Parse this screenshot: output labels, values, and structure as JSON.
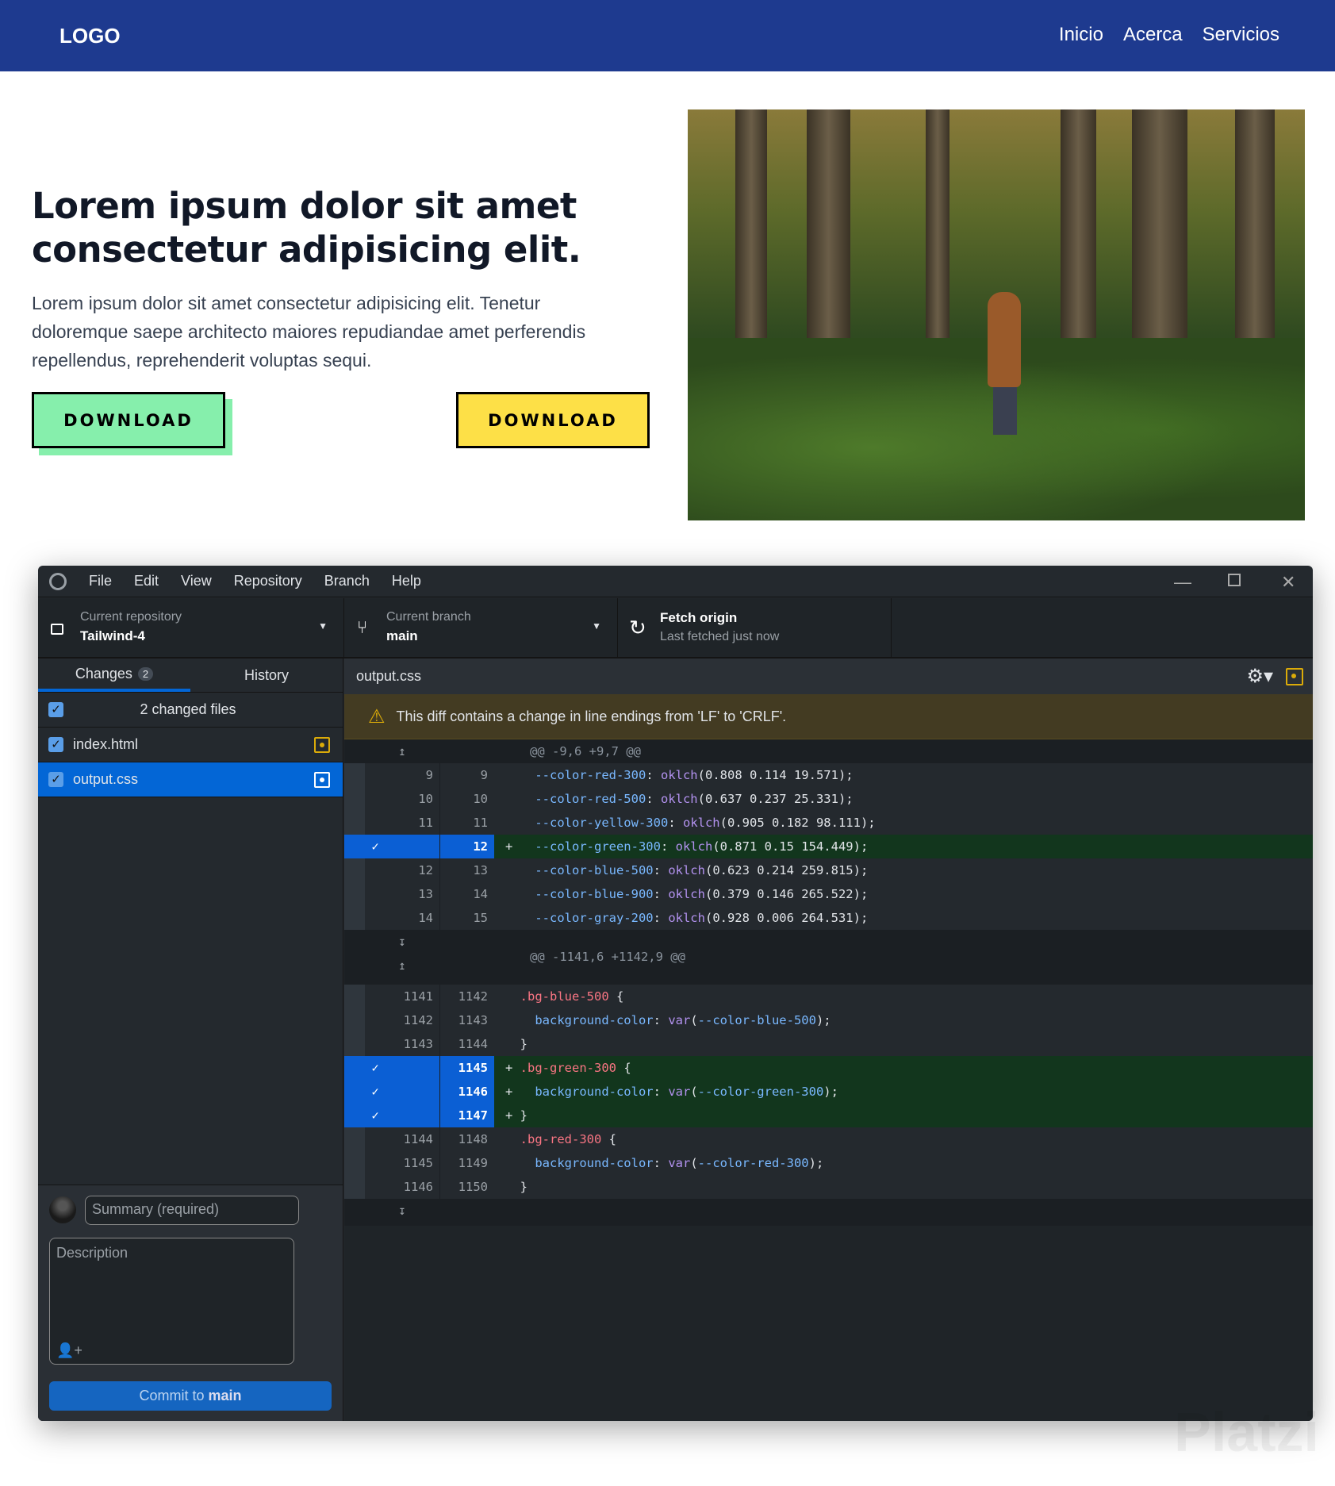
{
  "header": {
    "logo": "LOGO",
    "nav": [
      "Inicio",
      "Acerca",
      "Servicios"
    ]
  },
  "hero": {
    "title": "Lorem ipsum dolor sit amet consectetur adipisicing elit.",
    "text": "Lorem ipsum dolor sit amet consectetur adipisicing elit. Tenetur doloremque saepe architecto maiores repudiandae amet perferendis repellendus, reprehenderit voluptas sequi.",
    "button1": "DOWNLOAD",
    "button2": "DOWNLOAD"
  },
  "app": {
    "menu": [
      "File",
      "Edit",
      "View",
      "Repository",
      "Branch",
      "Help"
    ],
    "repo": {
      "label": "Current repository",
      "value": "Tailwind-4"
    },
    "branch": {
      "label": "Current branch",
      "value": "main"
    },
    "fetch": {
      "label": "Fetch origin",
      "sub": "Last fetched just now"
    },
    "tabs": {
      "changes": "Changes",
      "count": "2",
      "history": "History"
    },
    "changed_files": "2 changed files",
    "files": [
      "index.html",
      "output.css"
    ],
    "summary_placeholder": "Summary (required)",
    "description_placeholder": "Description",
    "commit": {
      "prefix": "Commit to ",
      "branch": "main"
    },
    "diff_file": "output.css",
    "warning": "This diff contains a change in line endings from 'LF' to 'CRLF'.",
    "hunks": [
      "@@ -9,6 +9,7 @@",
      "@@ -1141,6 +1142,9 @@"
    ],
    "lines1": [
      {
        "o": "9",
        "n": "9",
        "t": "",
        "c": [
          [
            "p",
            "    --color-red-300"
          ],
          [
            "v",
            ": "
          ],
          [
            "f",
            "oklch"
          ],
          [
            "v",
            "(0.808 0.114 19.571);"
          ]
        ]
      },
      {
        "o": "10",
        "n": "10",
        "t": "",
        "c": [
          [
            "p",
            "    --color-red-500"
          ],
          [
            "v",
            ": "
          ],
          [
            "f",
            "oklch"
          ],
          [
            "v",
            "(0.637 0.237 25.331);"
          ]
        ]
      },
      {
        "o": "11",
        "n": "11",
        "t": "",
        "c": [
          [
            "p",
            "    --color-yellow-300"
          ],
          [
            "v",
            ": "
          ],
          [
            "f",
            "oklch"
          ],
          [
            "v",
            "(0.905 0.182 98.111);"
          ]
        ]
      },
      {
        "o": "",
        "n": "12",
        "t": "add",
        "c": [
          [
            "v",
            "+   "
          ],
          [
            "p",
            "--color-green-300"
          ],
          [
            "v",
            ": "
          ],
          [
            "f",
            "oklch"
          ],
          [
            "v",
            "(0.871 0.15 154.449);"
          ]
        ]
      },
      {
        "o": "12",
        "n": "13",
        "t": "",
        "c": [
          [
            "p",
            "    --color-blue-500"
          ],
          [
            "v",
            ": "
          ],
          [
            "f",
            "oklch"
          ],
          [
            "v",
            "(0.623 0.214 259.815);"
          ]
        ]
      },
      {
        "o": "13",
        "n": "14",
        "t": "",
        "c": [
          [
            "p",
            "    --color-blue-900"
          ],
          [
            "v",
            ": "
          ],
          [
            "f",
            "oklch"
          ],
          [
            "v",
            "(0.379 0.146 265.522);"
          ]
        ]
      },
      {
        "o": "14",
        "n": "15",
        "t": "",
        "c": [
          [
            "p",
            "    --color-gray-200"
          ],
          [
            "v",
            ": "
          ],
          [
            "f",
            "oklch"
          ],
          [
            "v",
            "(0.928 0.006 264.531);"
          ]
        ]
      }
    ],
    "lines2": [
      {
        "o": "1141",
        "n": "1142",
        "t": "",
        "c": [
          [
            "sl",
            "  .bg-blue-500"
          ],
          [
            "v",
            " {"
          ]
        ]
      },
      {
        "o": "1142",
        "n": "1143",
        "t": "",
        "c": [
          [
            "p",
            "    background-color"
          ],
          [
            "v",
            ": "
          ],
          [
            "f",
            "var"
          ],
          [
            "v",
            "("
          ],
          [
            "p",
            "--color-blue-500"
          ],
          [
            "v",
            ");"
          ]
        ]
      },
      {
        "o": "1143",
        "n": "1144",
        "t": "",
        "c": [
          [
            "v",
            "  }"
          ]
        ]
      },
      {
        "o": "",
        "n": "1145",
        "t": "add",
        "c": [
          [
            "v",
            "+ "
          ],
          [
            "sl",
            ".bg-green-300"
          ],
          [
            "v",
            " {"
          ]
        ]
      },
      {
        "o": "",
        "n": "1146",
        "t": "add",
        "c": [
          [
            "v",
            "+   "
          ],
          [
            "p",
            "background-color"
          ],
          [
            "v",
            ": "
          ],
          [
            "f",
            "var"
          ],
          [
            "v",
            "("
          ],
          [
            "p",
            "--color-green-300"
          ],
          [
            "v",
            ");"
          ]
        ]
      },
      {
        "o": "",
        "n": "1147",
        "t": "add",
        "c": [
          [
            "v",
            "+ }"
          ]
        ]
      },
      {
        "o": "1144",
        "n": "1148",
        "t": "",
        "c": [
          [
            "sl",
            "  .bg-red-300"
          ],
          [
            "v",
            " {"
          ]
        ]
      },
      {
        "o": "1145",
        "n": "1149",
        "t": "",
        "c": [
          [
            "p",
            "    background-color"
          ],
          [
            "v",
            ": "
          ],
          [
            "f",
            "var"
          ],
          [
            "v",
            "("
          ],
          [
            "p",
            "--color-red-300"
          ],
          [
            "v",
            ");"
          ]
        ]
      },
      {
        "o": "1146",
        "n": "1150",
        "t": "",
        "c": [
          [
            "v",
            "  }"
          ]
        ]
      }
    ]
  },
  "watermark": "Platzi"
}
